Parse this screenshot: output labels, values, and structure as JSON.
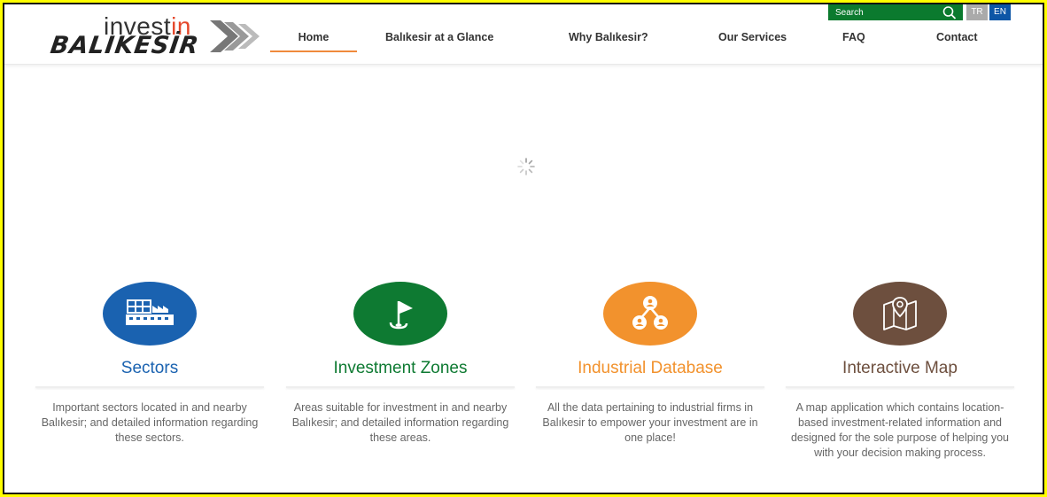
{
  "logo": {
    "line1_main": "invest",
    "line1_accent": "in",
    "line2": "BALIKESİR"
  },
  "nav": {
    "items": [
      {
        "label": "Home"
      },
      {
        "label": "Balıkesir at a Glance"
      },
      {
        "label": "Why Balıkesir?"
      },
      {
        "label": "Our Services"
      },
      {
        "label": "FAQ"
      },
      {
        "label": "Contact"
      }
    ]
  },
  "search": {
    "placeholder": "Search"
  },
  "languages": {
    "tr": "TR",
    "en": "EN"
  },
  "features": [
    {
      "title": "Sectors",
      "color": "#1a62b0",
      "icon": "factory-icon",
      "description": "Important sectors located in and nearby Balıkesir; and detailed information regarding these sectors."
    },
    {
      "title": "Investment Zones",
      "color": "#0e7a32",
      "icon": "golf-flag-icon",
      "description": "Areas suitable for investment in and nearby Balıkesir; and detailed information regarding these areas."
    },
    {
      "title": "Industrial Database",
      "color": "#f2922d",
      "icon": "network-users-icon",
      "description": "All the data pertaining to industrial firms in Balıkesir to empower your investment are in one place!"
    },
    {
      "title": "Interactive Map",
      "color": "#6d4f3e",
      "icon": "map-pin-icon",
      "description": "A map application which contains location-based investment-related information and designed for the sole purpose of helping you with your decision making process."
    }
  ]
}
